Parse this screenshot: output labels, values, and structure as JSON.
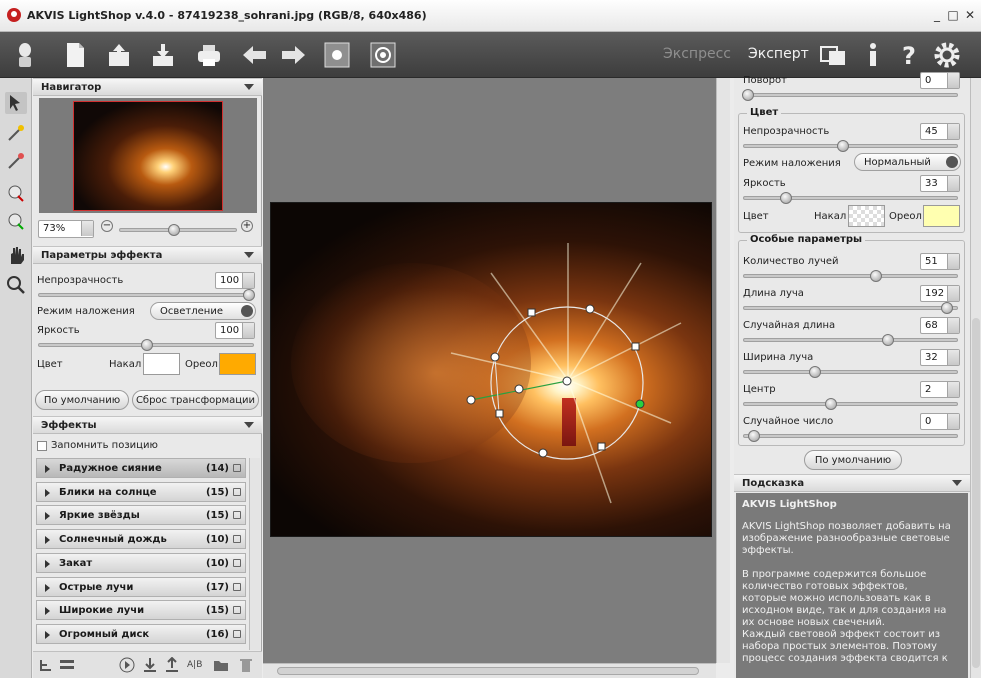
{
  "window": {
    "title": "AKVIS LightShop v.4.0 - 87419238_sohrani.jpg (RGB/8, 640x486)",
    "minimize": "_",
    "maximize": "□",
    "close": "✕"
  },
  "toolbar": {
    "icons": [
      "lamp-icon",
      "new-doc-icon",
      "open-icon",
      "save-icon",
      "print-icon",
      "undo-icon",
      "redo-icon",
      "before-icon",
      "after-icon"
    ],
    "mode_express": "Экспресс",
    "mode_expert": "Эксперт"
  },
  "navigator": {
    "title": "Навигатор",
    "zoom": "73%",
    "minus": "−",
    "plus": "+"
  },
  "effect_params": {
    "title": "Параметры эффекта",
    "opacity_label": "Непрозрачность",
    "opacity": "100",
    "opacity_pct": 1.0,
    "blend_label": "Режим наложения",
    "blend_value": "Осветление",
    "brightness_label": "Яркость",
    "brightness": "100",
    "brightness_pct": 0.5,
    "color_label": "Цвет",
    "core_label": "Накал",
    "halo_label": "Ореол",
    "core_color": "#ffffff",
    "halo_color": "#ffaa00"
  },
  "buttons": {
    "defaults": "По умолчанию",
    "reset_transform": "Сброс трансформации",
    "defaults_right": "По умолчанию"
  },
  "effects": {
    "title": "Эффекты",
    "remember": "Запомнить позицию",
    "items": [
      {
        "name": "Радужное сияние",
        "count": "(14)"
      },
      {
        "name": "Блики на солнце",
        "count": "(15)"
      },
      {
        "name": "Яркие звёзды",
        "count": "(15)"
      },
      {
        "name": "Солнечный дождь",
        "count": "(10)"
      },
      {
        "name": "Закат",
        "count": "(10)"
      },
      {
        "name": "Острые лучи",
        "count": "(17)"
      },
      {
        "name": "Широкие лучи",
        "count": "(15)"
      },
      {
        "name": "Огромный диск",
        "count": "(16)"
      }
    ],
    "bottom_ab": "A|B"
  },
  "right": {
    "rotation_label": "Поворот",
    "rotation": "0",
    "color_group": "Цвет",
    "opacity_label": "Непрозрачность",
    "opacity": "45",
    "blend_label": "Режим наложения",
    "blend_value": "Нормальный",
    "brightness_label": "Яркость",
    "brightness": "33",
    "color_label": "Цвет",
    "core_label": "Накал",
    "halo_label": "Ореол",
    "halo_color": "#ffffb0",
    "special_group": "Особые параметры",
    "params": [
      {
        "label": "Количество лучей",
        "value": "51",
        "pos": 0.62
      },
      {
        "label": "Длина луча",
        "value": "192",
        "pos": 0.97
      },
      {
        "label": "Случайная длина",
        "value": "68",
        "pos": 0.68
      },
      {
        "label": "Ширина луча",
        "value": "32",
        "pos": 0.32
      },
      {
        "label": "Центр",
        "value": "2",
        "pos": 0.4
      },
      {
        "label": "Случайное число",
        "value": "0",
        "pos": 0.02
      }
    ]
  },
  "hint": {
    "title": "Подсказка",
    "heading": "AKVIS LightShop",
    "p1": "AKVIS LightShop позволяет добавить на изображение разнообразные световые эффекты.",
    "p2": "В программе содержится большое количество готовых эффектов, которые можно использовать как в исходном виде, так и для создания на их основе новых свечений.",
    "p3": "Каждый световой эффект состоит из набора простых элементов. Поэтому процесс создания эффекта сводится к"
  }
}
